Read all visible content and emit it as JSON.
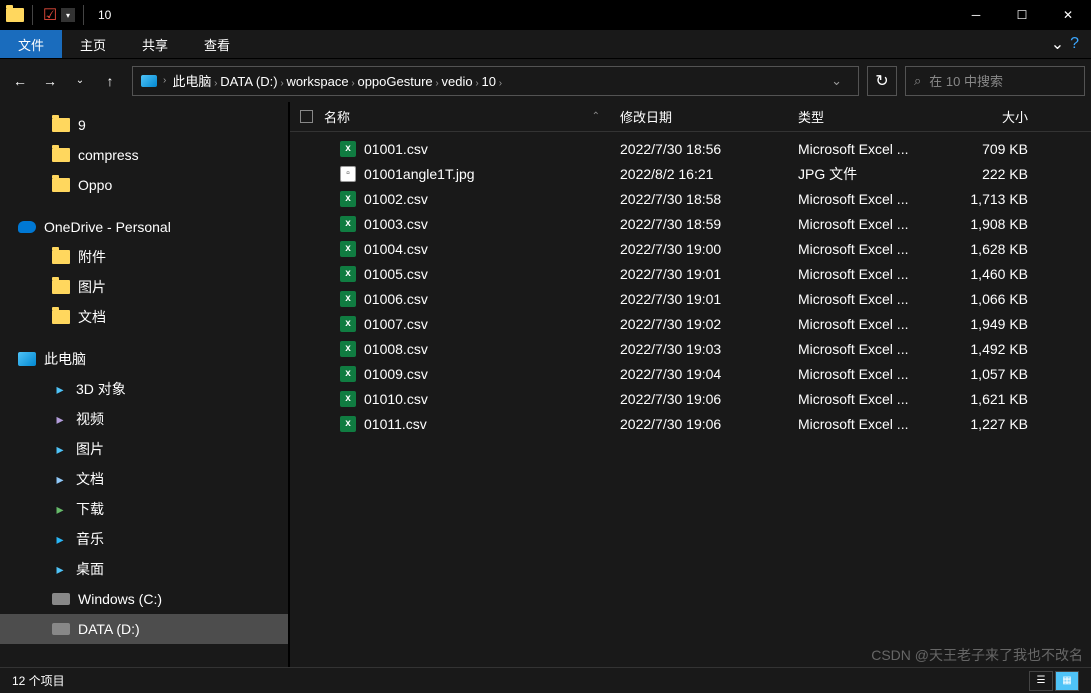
{
  "window": {
    "title": "10"
  },
  "ribbon": {
    "file": "文件",
    "home": "主页",
    "share": "共享",
    "view": "查看"
  },
  "breadcrumb": {
    "segments": [
      "此电脑",
      "DATA (D:)",
      "workspace",
      "oppoGesture",
      "vedio",
      "10"
    ]
  },
  "search": {
    "placeholder": "在 10 中搜索"
  },
  "sidebar": {
    "quick": [
      {
        "label": "9",
        "icon": "folder"
      },
      {
        "label": "compress",
        "icon": "folder"
      },
      {
        "label": "Oppo",
        "icon": "folder"
      }
    ],
    "onedrive": {
      "label": "OneDrive - Personal"
    },
    "onedrive_children": [
      {
        "label": "附件",
        "icon": "folder"
      },
      {
        "label": "图片",
        "icon": "folder"
      },
      {
        "label": "文档",
        "icon": "folder"
      }
    ],
    "pc": {
      "label": "此电脑"
    },
    "pc_children": [
      {
        "label": "3D 对象",
        "iconColor": "#4fc3f7"
      },
      {
        "label": "视频",
        "iconColor": "#b39ddb"
      },
      {
        "label": "图片",
        "iconColor": "#4fc3f7"
      },
      {
        "label": "文档",
        "iconColor": "#90caf9"
      },
      {
        "label": "下载",
        "iconColor": "#66bb6a"
      },
      {
        "label": "音乐",
        "iconColor": "#29b6f6"
      },
      {
        "label": "桌面",
        "iconColor": "#4fc3f7"
      },
      {
        "label": "Windows (C:)",
        "icon": "disk"
      },
      {
        "label": "DATA (D:)",
        "icon": "disk",
        "selected": true
      }
    ]
  },
  "columns": {
    "name": "名称",
    "date": "修改日期",
    "type": "类型",
    "size": "大小"
  },
  "files": [
    {
      "name": "01001.csv",
      "date": "2022/7/30 18:56",
      "type": "Microsoft Excel ...",
      "size": "709 KB",
      "ext": "csv"
    },
    {
      "name": "01001angle1T.jpg",
      "date": "2022/8/2 16:21",
      "type": "JPG 文件",
      "size": "222 KB",
      "ext": "jpg"
    },
    {
      "name": "01002.csv",
      "date": "2022/7/30 18:58",
      "type": "Microsoft Excel ...",
      "size": "1,713 KB",
      "ext": "csv"
    },
    {
      "name": "01003.csv",
      "date": "2022/7/30 18:59",
      "type": "Microsoft Excel ...",
      "size": "1,908 KB",
      "ext": "csv"
    },
    {
      "name": "01004.csv",
      "date": "2022/7/30 19:00",
      "type": "Microsoft Excel ...",
      "size": "1,628 KB",
      "ext": "csv"
    },
    {
      "name": "01005.csv",
      "date": "2022/7/30 19:01",
      "type": "Microsoft Excel ...",
      "size": "1,460 KB",
      "ext": "csv"
    },
    {
      "name": "01006.csv",
      "date": "2022/7/30 19:01",
      "type": "Microsoft Excel ...",
      "size": "1,066 KB",
      "ext": "csv"
    },
    {
      "name": "01007.csv",
      "date": "2022/7/30 19:02",
      "type": "Microsoft Excel ...",
      "size": "1,949 KB",
      "ext": "csv"
    },
    {
      "name": "01008.csv",
      "date": "2022/7/30 19:03",
      "type": "Microsoft Excel ...",
      "size": "1,492 KB",
      "ext": "csv"
    },
    {
      "name": "01009.csv",
      "date": "2022/7/30 19:04",
      "type": "Microsoft Excel ...",
      "size": "1,057 KB",
      "ext": "csv"
    },
    {
      "name": "01010.csv",
      "date": "2022/7/30 19:06",
      "type": "Microsoft Excel ...",
      "size": "1,621 KB",
      "ext": "csv"
    },
    {
      "name": "01011.csv",
      "date": "2022/7/30 19:06",
      "type": "Microsoft Excel ...",
      "size": "1,227 KB",
      "ext": "csv"
    }
  ],
  "status": {
    "count": "12 个项目"
  },
  "watermark": "CSDN @天王老子来了我也不改名"
}
